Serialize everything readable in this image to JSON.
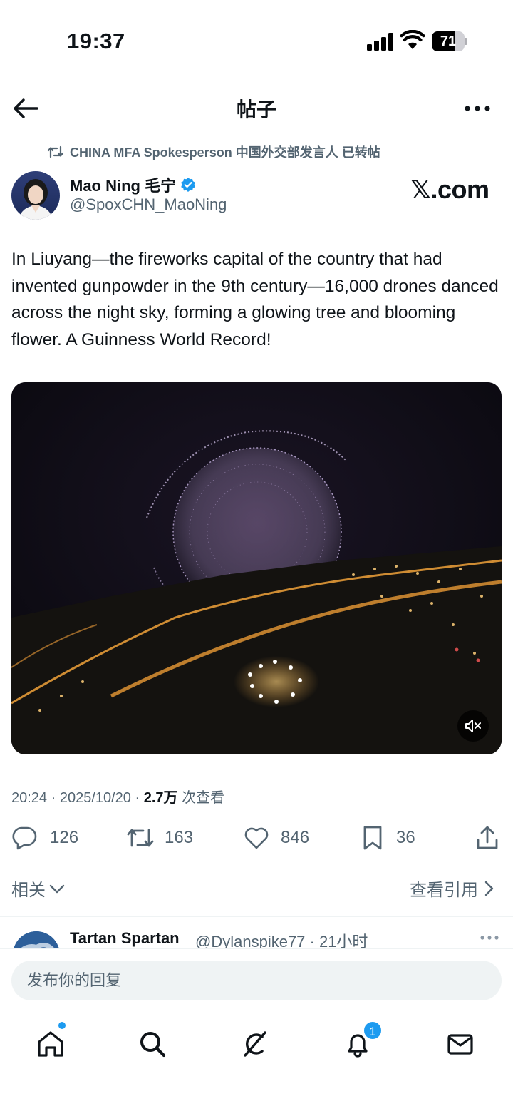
{
  "status_bar": {
    "time": "19:37",
    "battery": "71",
    "battery_level": 0.71,
    "icons": [
      "signal-icon",
      "wifi-icon",
      "battery-icon"
    ]
  },
  "header": {
    "title": "帖子",
    "back_icon": "arrow-left-icon",
    "more_icon": "more-horizontal-icon"
  },
  "repost": {
    "text": "CHINA MFA Spokesperson 中国外交部发言人 已转帖",
    "icon": "repost-icon"
  },
  "author": {
    "name": "Mao Ning 毛宁",
    "handle": "@SpoxCHN_MaoNing",
    "verified_color": "#1d9bf0",
    "watermark": "𝕏.com"
  },
  "post": {
    "text": "In Liuyang—the fireworks capital of the country that had invented gunpowder in the 9th century—16,000 drones danced across the night sky, forming a glowing tree and blooming flower. A Guinness World Record!"
  },
  "media": {
    "type": "video",
    "mute_icon": "volume-muted-icon"
  },
  "meta": {
    "time_date": "20:24 · 2025/10/20 · ",
    "views": "2.7万",
    "views_label": " 次查看"
  },
  "actions": {
    "replies": "126",
    "reposts": "163",
    "likes": "846",
    "bookmarks": "36"
  },
  "related": {
    "label": "相关",
    "quotes_label": "查看引用"
  },
  "reply_preview": {
    "name": "Tartan Spartan",
    "meta": "@Dylanspike77 · 21小时"
  },
  "compose": {
    "placeholder": "发布你的回复"
  },
  "nav": {
    "items": [
      "home-icon",
      "search-icon",
      "grok-icon",
      "notifications-icon",
      "messages-icon"
    ],
    "notification_count": "1",
    "accent": "#1d9bf0"
  }
}
